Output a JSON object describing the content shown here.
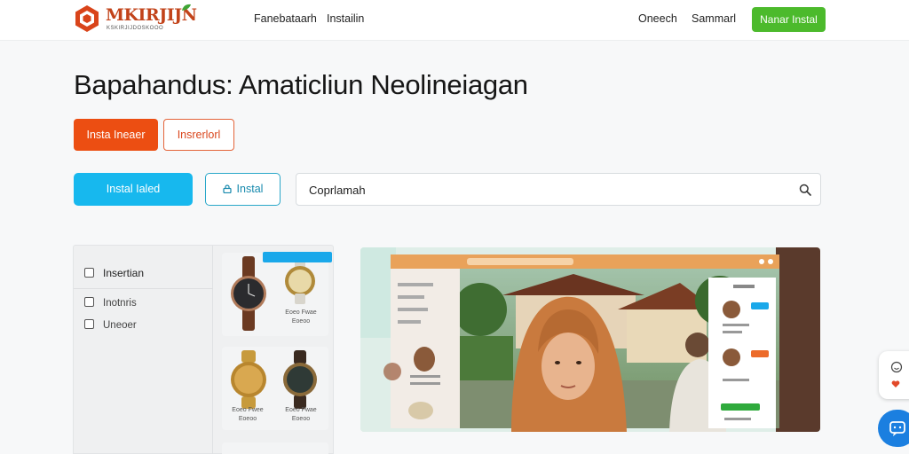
{
  "header": {
    "logo_text": "MKIRJIJN",
    "logo_subtext": "KSKIRJIJDOSKOOO",
    "nav": [
      "Fanebataarh",
      "Instailin"
    ],
    "right_links": [
      "Oneech",
      "Sammarl"
    ],
    "cta_label": "Nanar Instal"
  },
  "hero": {
    "title": "Bapahandus: Amaticliun Neolineiagan",
    "primary_button": "Insta Ineaer",
    "outline_button": "Insrerlorl",
    "cyan_button": "Instal Ialed",
    "cyan_outline_button": "Instal",
    "search_value": "Coprlamah"
  },
  "filters": {
    "heading": "Insertian",
    "options": [
      "Inotnris",
      "Uneoer"
    ]
  },
  "products": [
    {
      "label": "Eoeo Fwae",
      "sub": "Eoeoo"
    },
    {
      "label": "Eoeo Fwaoe",
      "sub": "Eoeoo"
    },
    {
      "label": "Eoeo Fwee",
      "sub": "Eoeoo"
    },
    {
      "label": "Eoeo Fwae",
      "sub": "Eoeoo"
    }
  ],
  "colors": {
    "accent_orange": "#ec4e12",
    "accent_cyan": "#17b8ee",
    "accent_green": "#4cba2c",
    "chat_blue": "#1b7fe0"
  },
  "icons": {
    "search": "search-icon",
    "lock": "lock-icon",
    "chat": "chat-icon",
    "smile": "smile-icon"
  }
}
